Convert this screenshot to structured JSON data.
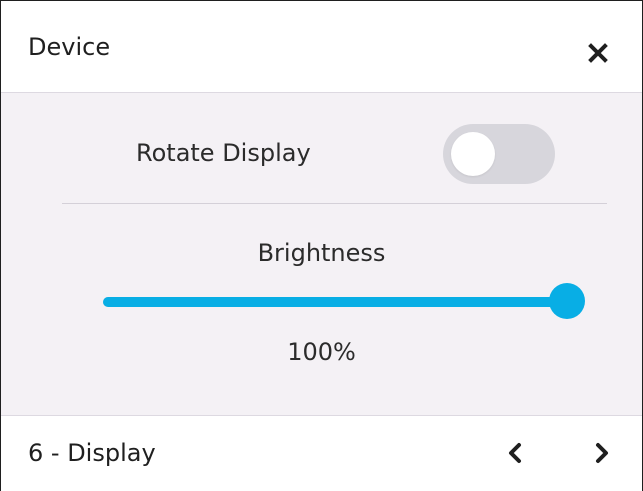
{
  "header": {
    "title": "Device",
    "close_icon": "close-icon"
  },
  "rotate_display": {
    "label": "Rotate Display",
    "enabled": false
  },
  "brightness": {
    "label": "Brightness",
    "value_text": "100%",
    "value": 100,
    "max": 100
  },
  "footer": {
    "title": "6 - Display",
    "prev_icon": "chevron-left-icon",
    "next_icon": "chevron-right-icon"
  },
  "colors": {
    "accent": "#08aee5",
    "toggle_off": "#d7d6dc",
    "content_bg": "#f4f1f5",
    "border": "#1f1f1f"
  }
}
